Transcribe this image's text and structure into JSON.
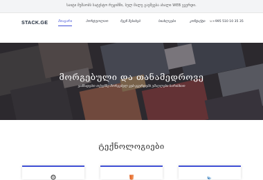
{
  "announcement": "საიტი მუშაობს სატესტო რეჟიმში, სულ მალე გაეშვება ახალი WEB გვერდი.",
  "header": {
    "logo": "STACK.GE",
    "nav": [
      "მთავარი",
      "პორტფოლიო",
      "ჩვენ შესახებ",
      "სიახლეები",
      "კონტაქტი"
    ],
    "phone": "+995 510 10 35 35"
  },
  "hero": {
    "title": "მორგებული და თანამედროვე",
    "subtitle": "ვამზადებთ თქვენზე მორგებულ ვებ-გვერდებს უმაღლესი ხარისხით"
  },
  "technologies": {
    "title": "ტექნოლოგიები",
    "cards": [
      {
        "icon": "wordpress-icon"
      },
      {
        "icon": "html-icon"
      },
      {
        "icon": "jquery-icon"
      }
    ]
  },
  "colors": {
    "accent": "#3f4fd6"
  }
}
